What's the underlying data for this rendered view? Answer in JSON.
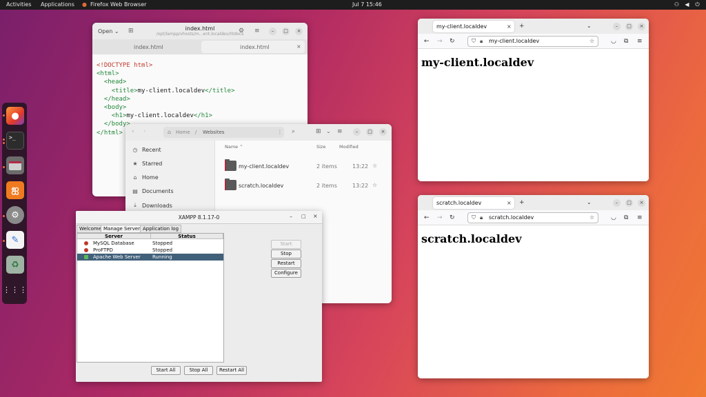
{
  "topbar": {
    "activities": "Activities",
    "applications": "Applications",
    "focused_app": "Firefox Web Browser",
    "clock": "Jul 7  15:46"
  },
  "dock": {
    "apps": [
      {
        "name": "firefox",
        "icon": "firefox-icon",
        "running": true
      },
      {
        "name": "terminal",
        "icon": "terminal-icon",
        "running": true
      },
      {
        "name": "files",
        "icon": "folder-icon",
        "running": true
      },
      {
        "name": "xampp",
        "icon": "xampp-icon",
        "running": false
      },
      {
        "name": "settings",
        "icon": "gear-icon",
        "running": true
      },
      {
        "name": "text-editor",
        "icon": "notepad-icon",
        "running": true
      },
      {
        "name": "trash",
        "icon": "trash-icon",
        "running": false
      },
      {
        "name": "show-apps",
        "icon": "grid-icon",
        "running": false
      }
    ]
  },
  "editor": {
    "open_label": "Open",
    "title": "index.html",
    "subtitle": "/opt/lampp/vhosts/m...ent.localdev/htdocs",
    "tabs": [
      "index.html",
      "index.html"
    ],
    "code_lines": {
      "l1": "<!DOCTYPE html>",
      "l2": "<html>",
      "l3": "<head>",
      "l4a": "<title>",
      "l4b": "my-client.localdev",
      "l4c": "</title>",
      "l5": "</head>",
      "l6": "<body>",
      "l7a": "<h1>",
      "l7b": "my-client.localdev",
      "l7c": "</h1>",
      "l8": "</body>",
      "l9": "</html>"
    }
  },
  "files": {
    "breadcrumb": {
      "home": "Home",
      "separator": "/",
      "current": "Websites"
    },
    "sidebar": [
      {
        "label": "Recent",
        "icon": "clock-icon"
      },
      {
        "label": "Starred",
        "icon": "star-icon"
      },
      {
        "label": "Home",
        "icon": "home-icon"
      },
      {
        "label": "Documents",
        "icon": "document-icon"
      },
      {
        "label": "Downloads",
        "icon": "download-icon"
      }
    ],
    "columns": {
      "name": "Name",
      "size": "Size",
      "modified": "Modified"
    },
    "rows": [
      {
        "name": "my-client.localdev",
        "size": "2 items",
        "modified": "13:22"
      },
      {
        "name": "scratch.localdev",
        "size": "2 items",
        "modified": "13:22"
      }
    ]
  },
  "xampp": {
    "title": "XAMPP 8.1.17-0",
    "tabs": [
      "Welcome",
      "Manage Servers",
      "Application log"
    ],
    "columns": {
      "server": "Server",
      "status": "Status"
    },
    "rows": [
      {
        "server": "MySQL Database",
        "status": "Stopped",
        "color": "#c0392b"
      },
      {
        "server": "ProFTPD",
        "status": "Stopped",
        "color": "#c0392b"
      },
      {
        "server": "Apache Web Server",
        "status": "Running",
        "color": "#5cb85c"
      }
    ],
    "buttons": {
      "start": "Start",
      "stop": "Stop",
      "restart": "Restart",
      "configure": "Configure"
    },
    "bottom_buttons": {
      "start_all": "Start All",
      "stop_all": "Stop All",
      "restart_all": "Restart All"
    }
  },
  "browser1": {
    "tab_title": "my-client.localdev",
    "url": "my-client.localdev",
    "heading": "my-client.localdev"
  },
  "browser2": {
    "tab_title": "scratch.localdev",
    "url": "scratch.localdev",
    "heading": "scratch.localdev"
  },
  "colors": {
    "accent": "#e95420",
    "running": "#5cb85c",
    "stopped": "#c0392b",
    "selection": "#41607a"
  }
}
